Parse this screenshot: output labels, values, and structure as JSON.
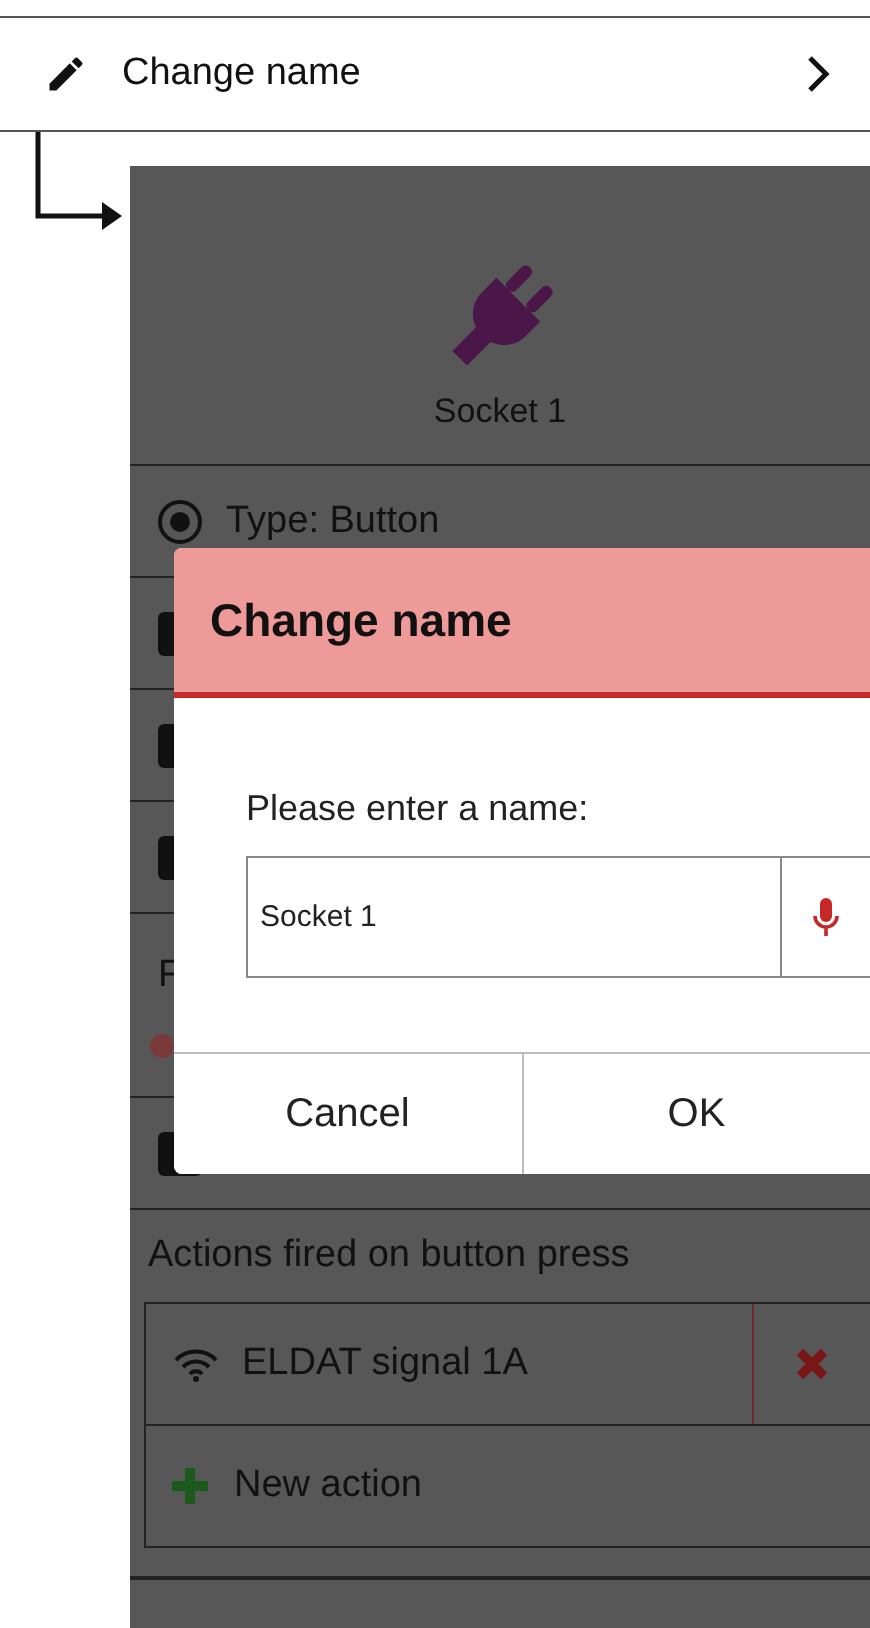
{
  "menu_item": {
    "label": "Change name"
  },
  "device": {
    "name": "Socket 1"
  },
  "settings_rows": [
    {
      "kind": "radio",
      "label": "Type: Button",
      "checked": true
    },
    {
      "kind": "icon"
    },
    {
      "kind": "icon"
    },
    {
      "kind": "icon"
    },
    {
      "kind": "slider",
      "label": "F"
    },
    {
      "kind": "icon"
    }
  ],
  "dialog": {
    "title": "Change name",
    "prompt": "Please enter a name:",
    "input_value": "Socket 1",
    "buttons": [
      "Cancel",
      "OK"
    ]
  },
  "actions": {
    "heading": "Actions fired on button press",
    "items": [
      {
        "label": "ELDAT signal 1A"
      }
    ],
    "add_label": "New action"
  }
}
